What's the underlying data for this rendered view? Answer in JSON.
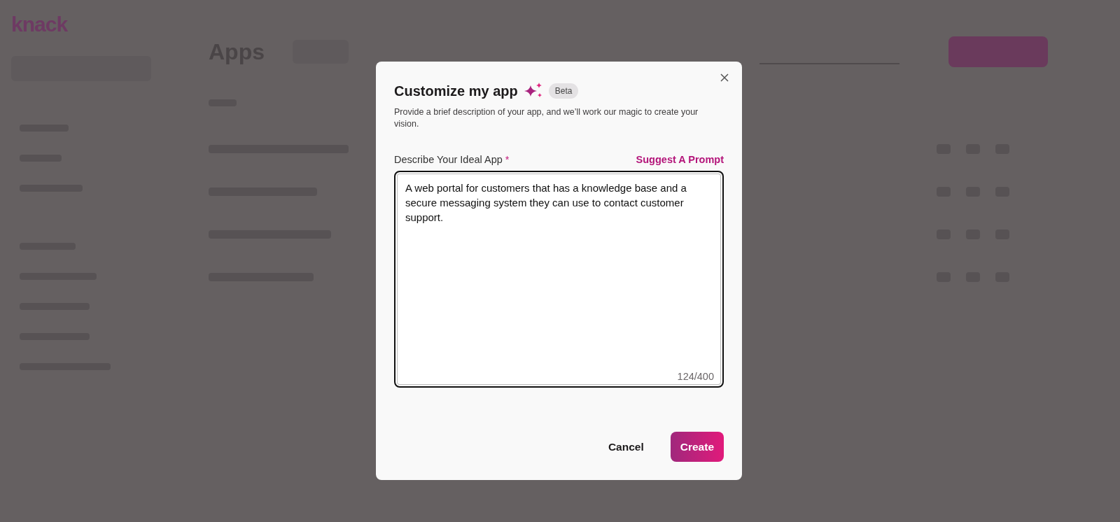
{
  "sidebar": {
    "logo": "knack"
  },
  "main": {
    "title": "Apps"
  },
  "dialog": {
    "title": "Customize my app",
    "badge": "Beta",
    "description": "Provide a brief description of your app, and we’ll work our magic to create your vision.",
    "field": {
      "label": "Describe Your Ideal App",
      "required_mark": "*",
      "link": "Suggest A Prompt",
      "value": "A web portal for customers that has a knowledge base and a secure messaging system they can use to contact customer support.",
      "counter": "124/400",
      "focused": true
    },
    "buttons": [
      {
        "label": "Cancel",
        "kind": "secondary"
      },
      {
        "label": "Create",
        "kind": "primary"
      }
    ]
  }
}
